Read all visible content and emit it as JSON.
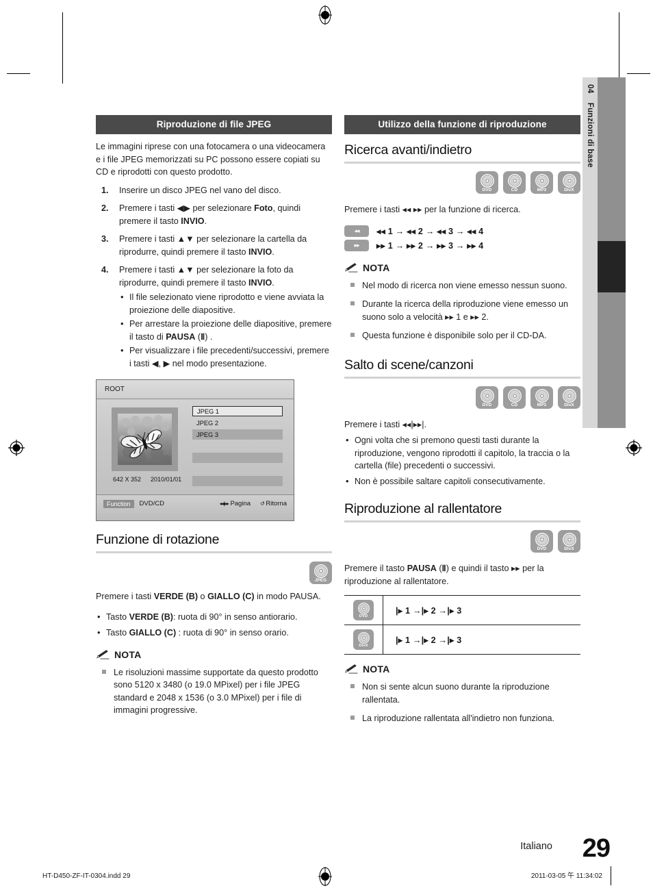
{
  "sidebar": {
    "chapter_number": "04",
    "chapter_title": "Funzioni di base"
  },
  "footer": {
    "language": "Italiano",
    "page_number": "29",
    "print_file": "HT-D450-ZF-IT-0304.indd   29",
    "print_timestamp": "2011-03-05   午 11:34:02"
  },
  "left_column": {
    "band_title": "Riproduzione di file JPEG",
    "intro": "Le immagini riprese con una fotocamera o una videocamera e i file JPEG memorizzati su PC possono essere copiati su CD e riprodotti con questo prodotto.",
    "steps": [
      {
        "num": "1.",
        "html": "Inserire un disco JPEG nel vano del disco."
      },
      {
        "num": "2.",
        "html": "Premere i tasti ◀▶ per selezionare <b>Foto</b>, quindi premere il tasto <b>INVIO</b>."
      },
      {
        "num": "3.",
        "html": "Premere i tasti ▲▼ per selezionare la cartella da riprodurre, quindi premere il tasto <b>INVIO</b>."
      },
      {
        "num": "4.",
        "html": "Premere i tasti ▲▼ per selezionare la foto da riprodurre, quindi premere il tasto <b>INVIO</b>."
      }
    ],
    "step4_bullets": [
      "Il file selezionato viene riprodotto e viene avviata la proiezione delle diapositive.",
      "Per arrestare la proiezione delle diapositive, premere il tasto di <b>PAUSA</b>  (<b>Ⅱ</b>) .",
      "Per visualizzare i file precedenti/successivi, premere i tasti ◀, ▶ nel modo presentazione."
    ],
    "osd": {
      "title": "ROOT",
      "files": [
        "JPEG 1",
        "JPEG 2",
        "JPEG 3"
      ],
      "resolution": "642 X 352",
      "date": "2010/01/01",
      "function_label": "Function",
      "function_value": "DVD/CD",
      "page_key": "◂◂|▸▸",
      "page_label": "Pagina",
      "return_key": "↺",
      "return_label": "Ritorna"
    },
    "rotation": {
      "heading": "Funzione di rotazione",
      "chips": [
        {
          "label": "JPEG"
        }
      ],
      "intro_html": "Premere i tasti <b>VERDE (B)</b> o <b>GIALLO (C)</b> in modo PAUSA.",
      "bullets": [
        "Tasto <b>VERDE (B)</b>: ruota di 90° in senso antiorario.",
        "Tasto <b>GIALLO (C)</b> : ruota di 90° in senso orario."
      ],
      "note_label": "NOTA",
      "notes": [
        "Le risoluzioni massime supportate da questo prodotto sono 5120 x 3480 (o 19.0 MPixel) per i file JPEG standard e 2048 x 1536 (o 3.0 MPixel) per i file di immagini progressive."
      ]
    }
  },
  "right_column": {
    "band_title": "Utilizzo della funzione di riproduzione",
    "search": {
      "heading": "Ricerca avanti/indietro",
      "chips": [
        {
          "label": "DVD"
        },
        {
          "label": "CD"
        },
        {
          "label": "MP3"
        },
        {
          "label": "DivX"
        }
      ],
      "intro_html": "Premere i tasti ◂◂ ▸▸ per la funzione di ricerca.",
      "speed_rows": [
        {
          "key": "◂◂",
          "sequence": "◂◂ 1 → ◂◂ 2 → ◂◂ 3 → ◂◂ 4"
        },
        {
          "key": "▸▸",
          "sequence": "▸▸ 1 → ▸▸ 2 → ▸▸ 3 → ▸▸ 4"
        }
      ],
      "note_label": "NOTA",
      "notes": [
        "Nel modo di ricerca non viene emesso nessun suono.",
        "Durante la ricerca della riproduzione viene emesso un suono solo a velocità ▸▸ 1 e ▸▸ 2.",
        "Questa funzione è disponibile solo per il CD-DA."
      ]
    },
    "skip": {
      "heading": "Salto di scene/canzoni",
      "chips": [
        {
          "label": "DVD"
        },
        {
          "label": "CD"
        },
        {
          "label": "MP3"
        },
        {
          "label": "DivX"
        }
      ],
      "intro_html": "Premere i tasti ◂◂|▸▸|.",
      "bullets": [
        "Ogni volta che si premono questi tasti durante la riproduzione, vengono riprodotti il capitolo, la traccia o la cartella (file) precedenti o successivi.",
        "Non è possibile saltare capitoli consecutivamente."
      ]
    },
    "slow": {
      "heading": "Riproduzione al rallentatore",
      "chips": [
        {
          "label": "DVD"
        },
        {
          "label": "DivX"
        }
      ],
      "intro_html": "Premere il tasto <b>PAUSA</b>  (<b>Ⅱ</b>) e quindi il tasto ▸▸ per la riproduzione al rallentatore.",
      "table_rows": [
        {
          "chip": "DVD",
          "sequence": "|▸ 1 →|▸ 2 →|▸ 3"
        },
        {
          "chip": "DivX",
          "sequence": "|▸ 1 →|▸ 2 →|▸ 3"
        }
      ],
      "note_label": "NOTA",
      "notes": [
        "Non si sente alcun suono durante la riproduzione rallentata.",
        "La riproduzione rallentata all'indietro non funziona."
      ]
    }
  }
}
